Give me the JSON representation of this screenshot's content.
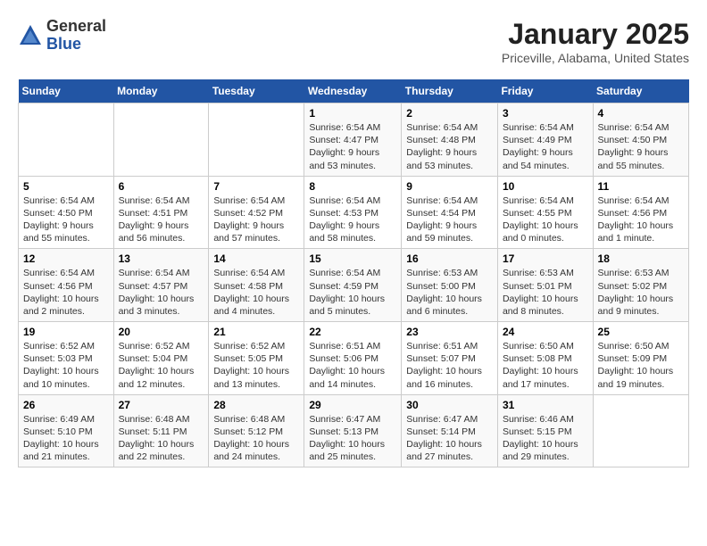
{
  "logo": {
    "general": "General",
    "blue": "Blue"
  },
  "title": "January 2025",
  "subtitle": "Priceville, Alabama, United States",
  "days_of_week": [
    "Sunday",
    "Monday",
    "Tuesday",
    "Wednesday",
    "Thursday",
    "Friday",
    "Saturday"
  ],
  "weeks": [
    [
      {
        "day": "",
        "info": ""
      },
      {
        "day": "",
        "info": ""
      },
      {
        "day": "",
        "info": ""
      },
      {
        "day": "1",
        "info": "Sunrise: 6:54 AM\nSunset: 4:47 PM\nDaylight: 9 hours\nand 53 minutes."
      },
      {
        "day": "2",
        "info": "Sunrise: 6:54 AM\nSunset: 4:48 PM\nDaylight: 9 hours\nand 53 minutes."
      },
      {
        "day": "3",
        "info": "Sunrise: 6:54 AM\nSunset: 4:49 PM\nDaylight: 9 hours\nand 54 minutes."
      },
      {
        "day": "4",
        "info": "Sunrise: 6:54 AM\nSunset: 4:50 PM\nDaylight: 9 hours\nand 55 minutes."
      }
    ],
    [
      {
        "day": "5",
        "info": "Sunrise: 6:54 AM\nSunset: 4:50 PM\nDaylight: 9 hours\nand 55 minutes."
      },
      {
        "day": "6",
        "info": "Sunrise: 6:54 AM\nSunset: 4:51 PM\nDaylight: 9 hours\nand 56 minutes."
      },
      {
        "day": "7",
        "info": "Sunrise: 6:54 AM\nSunset: 4:52 PM\nDaylight: 9 hours\nand 57 minutes."
      },
      {
        "day": "8",
        "info": "Sunrise: 6:54 AM\nSunset: 4:53 PM\nDaylight: 9 hours\nand 58 minutes."
      },
      {
        "day": "9",
        "info": "Sunrise: 6:54 AM\nSunset: 4:54 PM\nDaylight: 9 hours\nand 59 minutes."
      },
      {
        "day": "10",
        "info": "Sunrise: 6:54 AM\nSunset: 4:55 PM\nDaylight: 10 hours\nand 0 minutes."
      },
      {
        "day": "11",
        "info": "Sunrise: 6:54 AM\nSunset: 4:56 PM\nDaylight: 10 hours\nand 1 minute."
      }
    ],
    [
      {
        "day": "12",
        "info": "Sunrise: 6:54 AM\nSunset: 4:56 PM\nDaylight: 10 hours\nand 2 minutes."
      },
      {
        "day": "13",
        "info": "Sunrise: 6:54 AM\nSunset: 4:57 PM\nDaylight: 10 hours\nand 3 minutes."
      },
      {
        "day": "14",
        "info": "Sunrise: 6:54 AM\nSunset: 4:58 PM\nDaylight: 10 hours\nand 4 minutes."
      },
      {
        "day": "15",
        "info": "Sunrise: 6:54 AM\nSunset: 4:59 PM\nDaylight: 10 hours\nand 5 minutes."
      },
      {
        "day": "16",
        "info": "Sunrise: 6:53 AM\nSunset: 5:00 PM\nDaylight: 10 hours\nand 6 minutes."
      },
      {
        "day": "17",
        "info": "Sunrise: 6:53 AM\nSunset: 5:01 PM\nDaylight: 10 hours\nand 8 minutes."
      },
      {
        "day": "18",
        "info": "Sunrise: 6:53 AM\nSunset: 5:02 PM\nDaylight: 10 hours\nand 9 minutes."
      }
    ],
    [
      {
        "day": "19",
        "info": "Sunrise: 6:52 AM\nSunset: 5:03 PM\nDaylight: 10 hours\nand 10 minutes."
      },
      {
        "day": "20",
        "info": "Sunrise: 6:52 AM\nSunset: 5:04 PM\nDaylight: 10 hours\nand 12 minutes."
      },
      {
        "day": "21",
        "info": "Sunrise: 6:52 AM\nSunset: 5:05 PM\nDaylight: 10 hours\nand 13 minutes."
      },
      {
        "day": "22",
        "info": "Sunrise: 6:51 AM\nSunset: 5:06 PM\nDaylight: 10 hours\nand 14 minutes."
      },
      {
        "day": "23",
        "info": "Sunrise: 6:51 AM\nSunset: 5:07 PM\nDaylight: 10 hours\nand 16 minutes."
      },
      {
        "day": "24",
        "info": "Sunrise: 6:50 AM\nSunset: 5:08 PM\nDaylight: 10 hours\nand 17 minutes."
      },
      {
        "day": "25",
        "info": "Sunrise: 6:50 AM\nSunset: 5:09 PM\nDaylight: 10 hours\nand 19 minutes."
      }
    ],
    [
      {
        "day": "26",
        "info": "Sunrise: 6:49 AM\nSunset: 5:10 PM\nDaylight: 10 hours\nand 21 minutes."
      },
      {
        "day": "27",
        "info": "Sunrise: 6:48 AM\nSunset: 5:11 PM\nDaylight: 10 hours\nand 22 minutes."
      },
      {
        "day": "28",
        "info": "Sunrise: 6:48 AM\nSunset: 5:12 PM\nDaylight: 10 hours\nand 24 minutes."
      },
      {
        "day": "29",
        "info": "Sunrise: 6:47 AM\nSunset: 5:13 PM\nDaylight: 10 hours\nand 25 minutes."
      },
      {
        "day": "30",
        "info": "Sunrise: 6:47 AM\nSunset: 5:14 PM\nDaylight: 10 hours\nand 27 minutes."
      },
      {
        "day": "31",
        "info": "Sunrise: 6:46 AM\nSunset: 5:15 PM\nDaylight: 10 hours\nand 29 minutes."
      },
      {
        "day": "",
        "info": ""
      }
    ]
  ]
}
